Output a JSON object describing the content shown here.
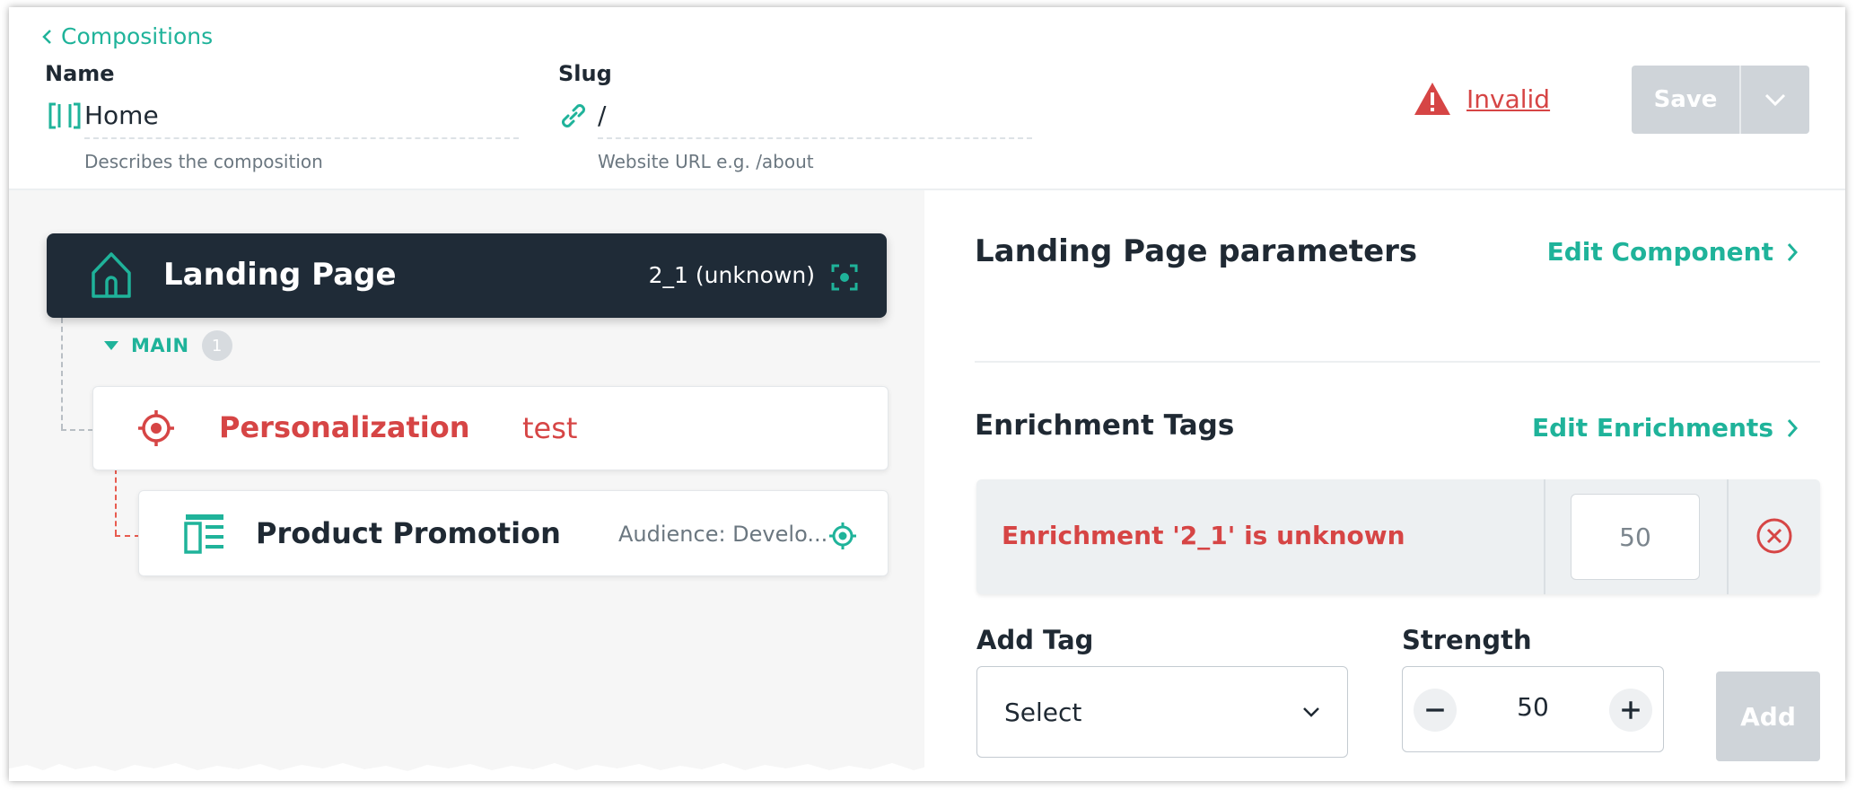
{
  "header": {
    "back_label": "Compositions",
    "name": {
      "label": "Name",
      "value": "Home",
      "help": "Describes the composition"
    },
    "slug": {
      "label": "Slug",
      "value": "/",
      "help": "Website URL e.g. /about"
    },
    "status": "Invalid",
    "save_label": "Save"
  },
  "canvas": {
    "root": {
      "title": "Landing Page",
      "meta": "2_1 (unknown)"
    },
    "slot": {
      "name": "MAIN",
      "count": "1"
    },
    "personalization": {
      "title": "Personalization",
      "name": "test"
    },
    "promotion": {
      "title": "Product Promotion",
      "audience": "Audience: Develo..."
    }
  },
  "panel": {
    "title": "Landing Page parameters",
    "edit_component": "Edit Component",
    "enrichment_title": "Enrichment Tags",
    "edit_enrichments": "Edit Enrichments",
    "enrichment_error": "Enrichment '2_1' is unknown",
    "enrichment_value": "50",
    "add_tag_label": "Add Tag",
    "select_value": "Select",
    "strength_label": "Strength",
    "strength_value": "50",
    "add_label": "Add"
  },
  "colors": {
    "accent": "#1fb39a",
    "error": "#d64545",
    "dark": "#1f2b37",
    "disabled": "#cfd4d9"
  },
  "icons": [
    "chevron-left-icon",
    "component-icon",
    "link-icon",
    "warning-icon",
    "chevron-down-icon",
    "home-icon",
    "focus-icon",
    "target-icon",
    "layout-icon",
    "pin-icon",
    "chevron-right-icon",
    "remove-icon",
    "minus-icon",
    "plus-icon"
  ]
}
